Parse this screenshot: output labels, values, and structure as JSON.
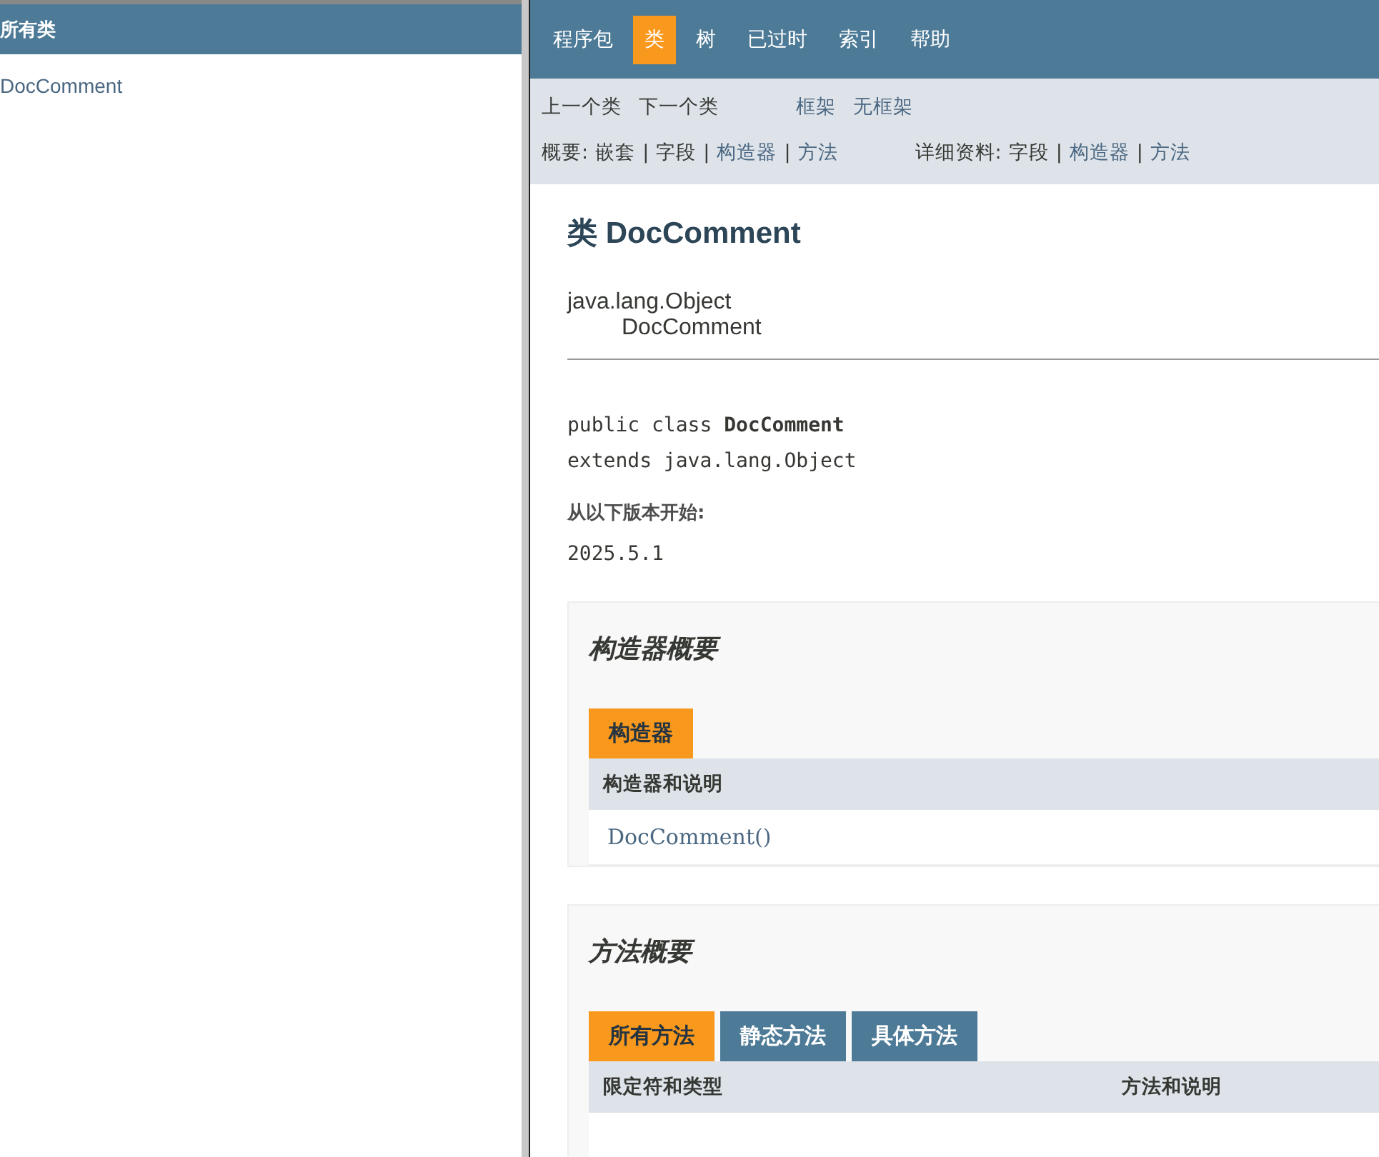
{
  "left_frame": {
    "title": "所有类",
    "items": [
      {
        "label": "DocComment"
      }
    ]
  },
  "top_nav": [
    {
      "label": "程序包",
      "selected": false
    },
    {
      "label": "类",
      "selected": true
    },
    {
      "label": "树",
      "selected": false
    },
    {
      "label": "已过时",
      "selected": false
    },
    {
      "label": "索引",
      "selected": false
    },
    {
      "label": "帮助",
      "selected": false
    }
  ],
  "sub_nav": {
    "prev_next": [
      {
        "label": "上一个类",
        "link": false
      },
      {
        "label": "下一个类",
        "link": false
      }
    ],
    "frames": [
      {
        "label": "框架",
        "link": true
      },
      {
        "label": "无框架",
        "link": true
      }
    ]
  },
  "summary": {
    "label": "概要:",
    "separator": "|",
    "items": [
      {
        "label": "嵌套",
        "link": false
      },
      {
        "label": "字段",
        "link": false
      },
      {
        "label": "构造器",
        "link": true
      },
      {
        "label": "方法",
        "link": true
      }
    ]
  },
  "detail": {
    "label": "详细资料:",
    "separator": "|",
    "items": [
      {
        "label": "字段",
        "link": false
      },
      {
        "label": "构造器",
        "link": true
      },
      {
        "label": "方法",
        "link": true
      }
    ]
  },
  "header": {
    "title": "类 DocComment",
    "inheritance": [
      "java.lang.Object",
      "DocComment"
    ]
  },
  "signature": {
    "prefix": "public class ",
    "name": "DocComment",
    "extends": "extends java.lang.Object"
  },
  "since": {
    "label": "从以下版本开始:",
    "value": "2025.5.1"
  },
  "constructor_summary": {
    "title": "构造器概要",
    "tabs": [
      {
        "label": "构造器",
        "selected": true
      }
    ],
    "columns": [
      "构造器和说明"
    ],
    "rows": [
      {
        "cells": [
          "DocComment()"
        ]
      }
    ]
  },
  "method_summary": {
    "title": "方法概要",
    "tabs": [
      {
        "label": "所有方法",
        "selected": true
      },
      {
        "label": "静态方法",
        "selected": false
      },
      {
        "label": "具体方法",
        "selected": false
      }
    ],
    "columns": [
      "限定符和类型",
      "方法和说明"
    ]
  }
}
